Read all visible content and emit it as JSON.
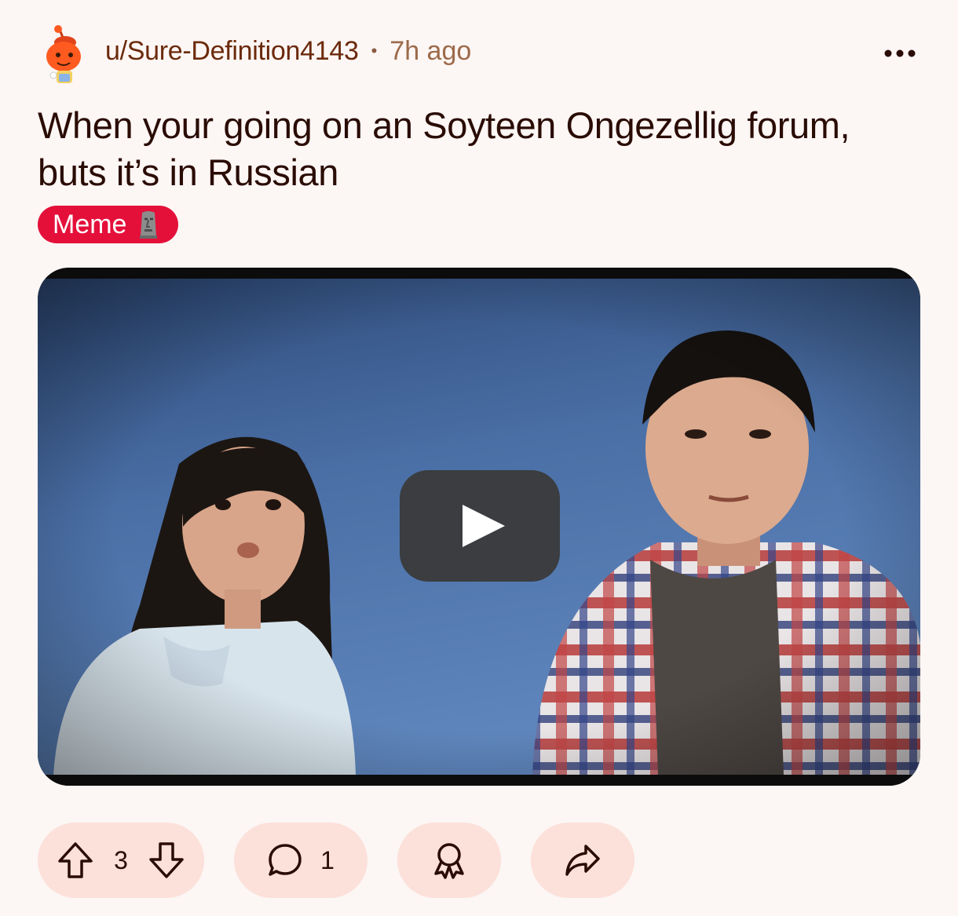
{
  "post": {
    "author": "u/Sure-Definition4143",
    "separator": "•",
    "time": "7h ago",
    "title": "When your going on an Soyteen Ongezellig forum, buts it’s in Russian",
    "flair": {
      "label": "Meme",
      "emoji_icon": "moai-icon",
      "color": "#e4103a"
    },
    "media": {
      "type": "video",
      "play_icon": "play-icon"
    },
    "actions": {
      "upvote_icon": "arrow-up-icon",
      "score": "3",
      "downvote_icon": "arrow-down-icon",
      "comment_icon": "speech-bubble-icon",
      "comments": "1",
      "award_icon": "award-icon",
      "share_icon": "share-arrow-icon"
    },
    "more_icon": "ellipsis-icon"
  },
  "colors": {
    "background": "#fcf6f4",
    "pill": "#fce0da",
    "username": "#6b2a0c",
    "text": "#2a0c04"
  }
}
